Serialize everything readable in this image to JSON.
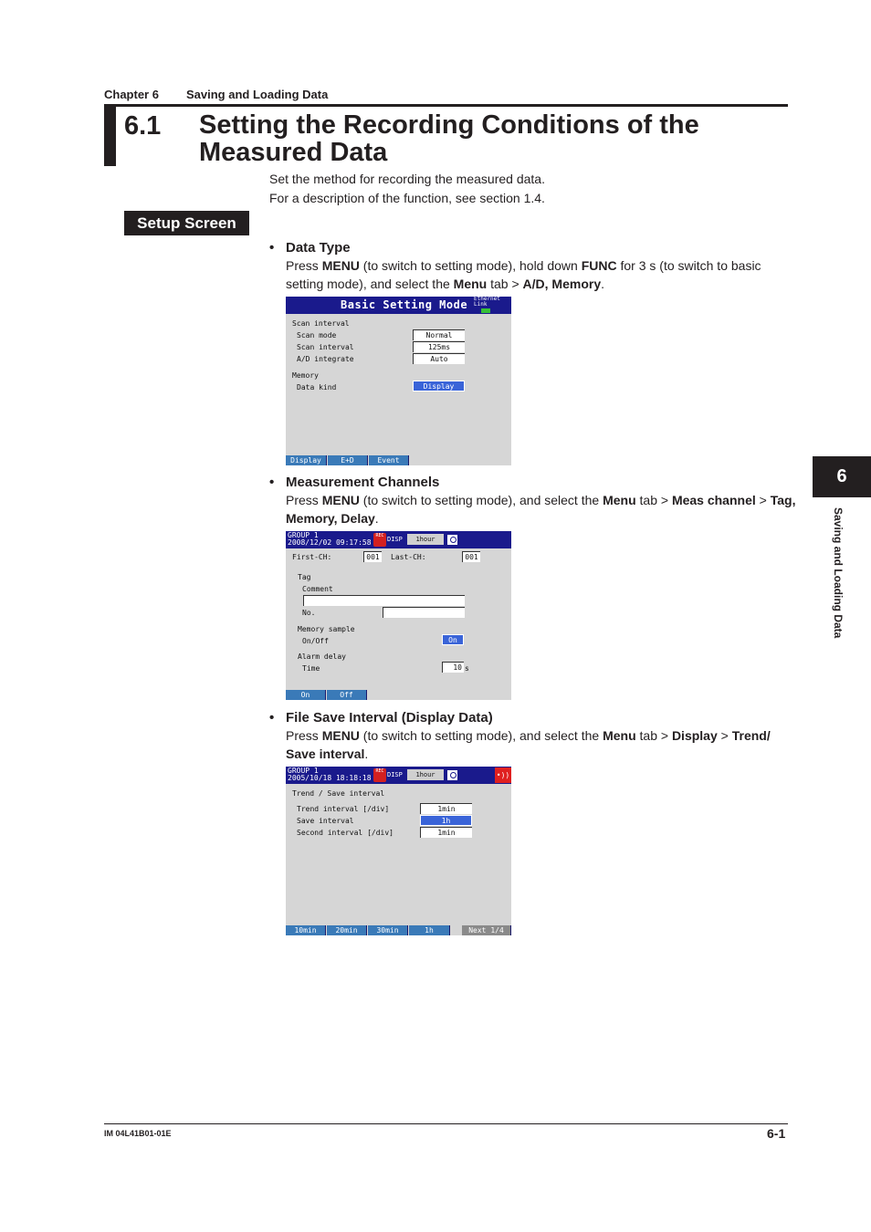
{
  "header": {
    "chapter_num": "Chapter 6",
    "chapter_title": "Saving and Loading Data"
  },
  "section": {
    "number": "6.1",
    "title_line1": "Setting the Recording Conditions of the",
    "title_line2": "Measured Data",
    "intro_line1": "Set the method for recording the measured data.",
    "intro_line2": "For a description of the function, see section 1.4."
  },
  "setup_tab": "Setup Screen",
  "items": [
    {
      "bullet": "•",
      "title": "Data Type",
      "para": [
        {
          "t": "Press ",
          "b": false
        },
        {
          "t": "MENU",
          "b": true
        },
        {
          "t": " (to switch to setting mode), hold down ",
          "b": false
        },
        {
          "t": "FUNC",
          "b": true
        },
        {
          "t": " for 3 s (to switch to basic setting mode), and select the ",
          "b": false
        },
        {
          "t": "Menu",
          "b": true
        },
        {
          "t": " tab > ",
          "b": false
        },
        {
          "t": "A/D, Memory",
          "b": true
        },
        {
          "t": ".",
          "b": false
        }
      ]
    },
    {
      "bullet": "•",
      "title": "Measurement Channels",
      "para": [
        {
          "t": "Press ",
          "b": false
        },
        {
          "t": "MENU",
          "b": true
        },
        {
          "t": " (to switch to setting mode), and select the ",
          "b": false
        },
        {
          "t": "Menu",
          "b": true
        },
        {
          "t": " tab > ",
          "b": false
        },
        {
          "t": "Meas channel",
          "b": true
        },
        {
          "t": " > ",
          "b": false
        },
        {
          "t": "Tag, Memory, Delay",
          "b": true
        },
        {
          "t": ".",
          "b": false
        }
      ]
    },
    {
      "bullet": "•",
      "title": "File Save Interval (Display Data)",
      "para": [
        {
          "t": "Press ",
          "b": false
        },
        {
          "t": "MENU",
          "b": true
        },
        {
          "t": " (to switch to setting mode), and select the ",
          "b": false
        },
        {
          "t": "Menu",
          "b": true
        },
        {
          "t": " tab > ",
          "b": false
        },
        {
          "t": "Display",
          "b": true
        },
        {
          "t": " > ",
          "b": false
        },
        {
          "t": "Trend/ Save interval",
          "b": true
        },
        {
          "t": ".",
          "b": false
        }
      ]
    }
  ],
  "screen1": {
    "title": "Basic Setting Mode",
    "eth_line1": "Ethernet",
    "eth_line2": "Link",
    "scan_group": "Scan interval",
    "scan_mode_label": "Scan mode",
    "scan_mode_value": "Normal",
    "scan_interval_label": "Scan interval",
    "scan_interval_value": "125ms",
    "ad_label": "A/D integrate",
    "ad_value": "Auto",
    "memory_group": "Memory",
    "data_kind_label": "Data kind",
    "data_kind_value": "Display",
    "softkeys": [
      "Display",
      "E+D",
      "Event"
    ]
  },
  "screen2": {
    "group": "GROUP 1",
    "datetime": "2008/12/02 09:17:58",
    "rec_icon": "REC",
    "disp": "DISP",
    "hour": "1hour",
    "first_ch_label": "First-CH:",
    "first_ch_value": "001",
    "last_ch_label": "Last-CH:",
    "last_ch_value": "001",
    "tag_group": "Tag",
    "comment_label": "Comment",
    "comment_value": "",
    "no_label": "No.",
    "no_value": "",
    "memory_group": "Memory sample",
    "onoff_label": "On/Off",
    "onoff_value": "On",
    "alarm_group": "Alarm delay",
    "time_label": "Time",
    "time_value": "10",
    "time_unit": "s",
    "softkeys": [
      "On",
      "Off"
    ]
  },
  "screen3": {
    "group": "GROUP 1",
    "datetime": "2005/10/18 18:18:18",
    "rec_icon": "REC",
    "disp": "DISP",
    "hour": "1hour",
    "alarm_icon": "•))",
    "section_label": "Trend / Save interval",
    "trend_label": "Trend interval [/div]",
    "trend_value": "1min",
    "save_label": "Save interval",
    "save_value": "1h",
    "second_label": "Second interval [/div]",
    "second_value": "1min",
    "softkeys": [
      "10min",
      "20min",
      "30min",
      "1h"
    ],
    "next_key": "Next 1/4"
  },
  "side_tab": {
    "number": "6",
    "label": "Saving and Loading Data"
  },
  "footer": {
    "doc_id": "IM 04L41B01-01E",
    "page": "6-1"
  }
}
